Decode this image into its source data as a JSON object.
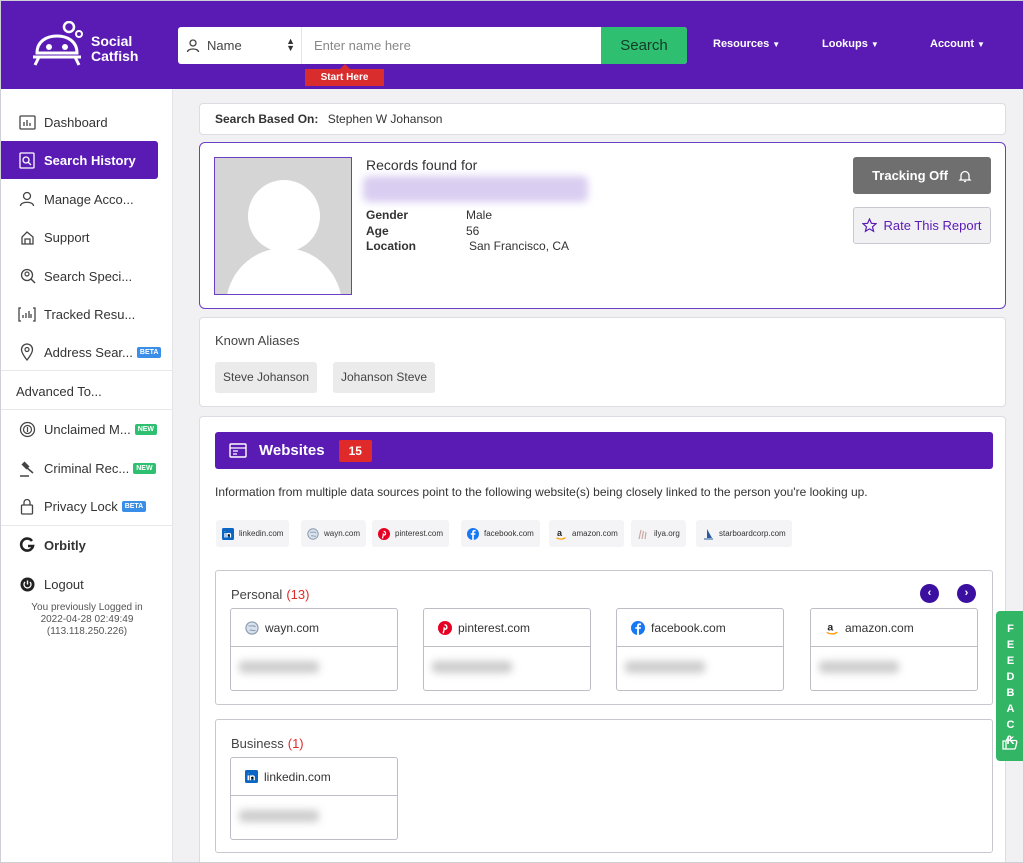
{
  "app": {
    "logo_line1": "Social",
    "logo_line2": "Catfish"
  },
  "header": {
    "search_type": "Name",
    "search_placeholder": "Enter name here",
    "search_button": "Search",
    "start_tag": "Start Here",
    "nav": [
      "Resources",
      "Lookups",
      "Account"
    ]
  },
  "sidebar": {
    "items": [
      {
        "label": "Dashboard",
        "icon": "dashboard-icon"
      },
      {
        "label": "Search History",
        "icon": "search-history-icon",
        "active": true
      },
      {
        "label": "Manage Acco...",
        "icon": "user-icon"
      },
      {
        "label": "Support",
        "icon": "support-icon"
      },
      {
        "label": "Search Speci...",
        "icon": "search-specialist-icon"
      },
      {
        "label": "Tracked Resu...",
        "icon": "tracked-results-icon"
      },
      {
        "label": "Address Sear...",
        "icon": "location-pin-icon",
        "badge": "BETA"
      },
      {
        "label": "Unclaimed M...",
        "icon": "money-icon",
        "badge": "NEW"
      },
      {
        "label": "Criminal Rec...",
        "icon": "gavel-icon",
        "badge": "NEW"
      },
      {
        "label": "Privacy Lock",
        "icon": "lock-icon",
        "badge": "BETA"
      },
      {
        "label": "Orbitly",
        "icon": "orbitly-icon"
      },
      {
        "label": "Logout",
        "icon": "power-icon"
      }
    ],
    "advanced_heading": "Advanced To...",
    "last_login_line1": "You previously Logged in",
    "last_login_line2": "2022-04-28 02:49:49",
    "last_login_line3": "(113.118.250.226)"
  },
  "search_based_on": {
    "label": "Search Based On:",
    "value": "Stephen W Johanson"
  },
  "profile": {
    "records_label": "Records found for",
    "gender_label": "Gender",
    "gender": "Male",
    "age_label": "Age",
    "age": "56",
    "location_label": "Location",
    "location": "San Francisco, CA",
    "tracking_button": "Tracking Off",
    "rate_button": "Rate This Report"
  },
  "aliases": {
    "title": "Known Aliases",
    "items": [
      "Steve Johanson",
      "Johanson Steve"
    ]
  },
  "websites": {
    "title": "Websites",
    "count": "15",
    "description": "Information from multiple data sources point to the following website(s) being closely linked to the person you're looking up.",
    "chips": [
      "linkedin.com",
      "wayn.com",
      "pinterest.com",
      "facebook.com",
      "amazon.com",
      "ilya.org",
      "starboardcorp.com"
    ],
    "personal": {
      "title": "Personal",
      "count": "(13)",
      "cards": [
        "wayn.com",
        "pinterest.com",
        "facebook.com",
        "amazon.com"
      ]
    },
    "business": {
      "title": "Business",
      "count": "(1)",
      "cards": [
        "linkedin.com"
      ]
    }
  },
  "feedback": {
    "label": "FEEDBACK"
  },
  "colors": {
    "brand": "#5a1bb5",
    "search_green": "#2fbf71",
    "alert_red": "#e02a2a",
    "feedback_green": "#32b565"
  }
}
